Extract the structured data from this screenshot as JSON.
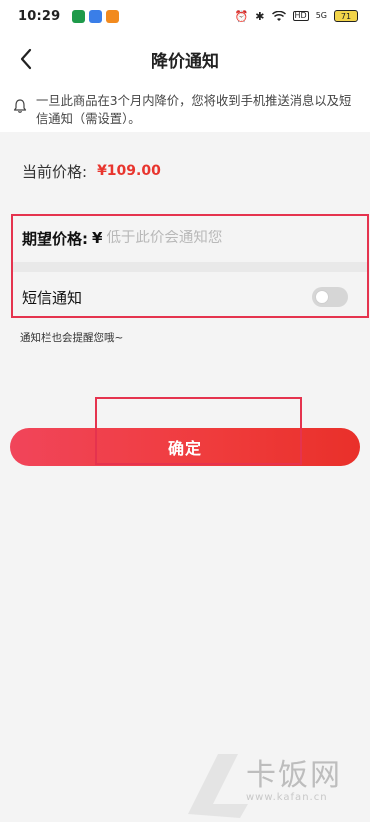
{
  "status_bar": {
    "time": "10:29",
    "battery": "71",
    "signal": "5G",
    "hd": "HD"
  },
  "header": {
    "title": "降价通知",
    "back_icon": "chevron-left-icon"
  },
  "notice": {
    "icon": "bell-icon",
    "text": "一旦此商品在3个月内降价，您将收到手机推送消息以及短信通知（需设置）。"
  },
  "current_price": {
    "label": "当前价格:",
    "value": "¥109.00"
  },
  "expected_price": {
    "label": "期望价格:",
    "currency": "¥",
    "value": "",
    "placeholder": "低于此价会通知您"
  },
  "sms": {
    "label": "短信通知",
    "enabled": false
  },
  "hint": "通知栏也会提醒您哦~",
  "confirm_label": "确定",
  "watermark": {
    "text": "卡饭网",
    "url": "www.kafan.cn"
  },
  "colors": {
    "accent": "#e8352e",
    "highlight": "#e5334e"
  }
}
